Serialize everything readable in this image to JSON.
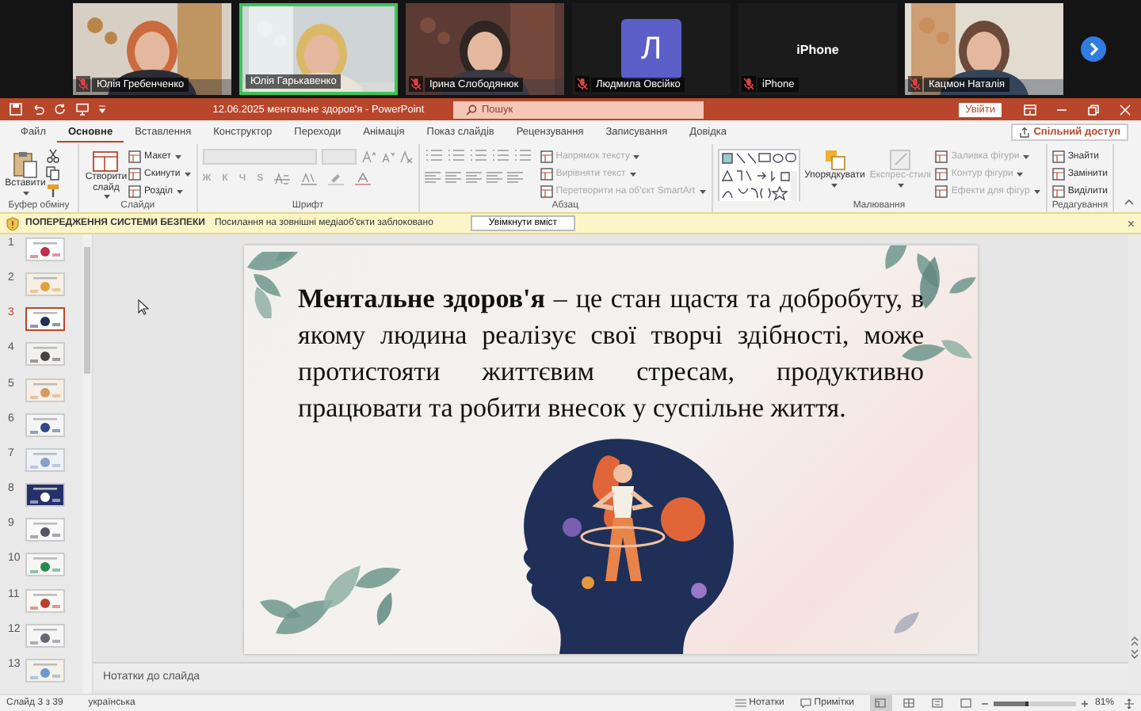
{
  "meeting": {
    "participants": [
      {
        "name": "Юлія Гребенченко",
        "kind": "video",
        "muted": true,
        "speaking": false
      },
      {
        "name": "Юлія Гарькавенко",
        "kind": "video",
        "muted": false,
        "speaking": true
      },
      {
        "name": "Ірина Слободянюк",
        "kind": "video",
        "muted": true,
        "speaking": false
      },
      {
        "name": "Людмила Овсійко",
        "kind": "avatar",
        "initial": "Л",
        "muted": true,
        "speaking": false
      },
      {
        "name": "iPhone",
        "kind": "device",
        "title": "iPhone",
        "muted": true,
        "speaking": false
      },
      {
        "name": "Кацмон Наталія",
        "kind": "video",
        "muted": true,
        "speaking": false
      }
    ]
  },
  "title_bar": {
    "title": "12.06.2025 ментальне здоров'я - PowerPoint",
    "search": {
      "placeholder": "Пошук"
    },
    "sign_in": "Увійти"
  },
  "ribbon": {
    "tabs": [
      {
        "label": "Файл",
        "selected": false
      },
      {
        "label": "Основне",
        "selected": true
      },
      {
        "label": "Вставлення",
        "selected": false
      },
      {
        "label": "Конструктор",
        "selected": false
      },
      {
        "label": "Переходи",
        "selected": false
      },
      {
        "label": "Анімація",
        "selected": false
      },
      {
        "label": "Показ слайдів",
        "selected": false
      },
      {
        "label": "Рецензування",
        "selected": false
      },
      {
        "label": "Записування",
        "selected": false
      },
      {
        "label": "Довідка",
        "selected": false
      }
    ],
    "share": "Спільний доступ",
    "groups": [
      {
        "kind": "clipboard",
        "title": "Буфер обміну",
        "items": [
          {
            "label": "Вставити"
          }
        ]
      },
      {
        "kind": "slides",
        "title": "Слайди",
        "items": [
          {
            "label": "Створити слайд"
          },
          {
            "label": "Макет"
          },
          {
            "label": "Скинути"
          },
          {
            "label": "Розділ"
          }
        ]
      },
      {
        "kind": "font",
        "title": "Шрифт",
        "disabled": true,
        "buttons": [
          "Ж",
          "К",
          "Ч",
          "S"
        ]
      },
      {
        "kind": "paragraph",
        "title": "Абзац",
        "items": [
          {
            "label": "Напрямок тексту",
            "disabled": true
          },
          {
            "label": "Вирівняти текст",
            "disabled": true
          },
          {
            "label": "Перетворити на об'єкт SmartArt",
            "disabled": true
          }
        ]
      },
      {
        "kind": "drawing",
        "title": "Малювання",
        "items": [
          {
            "label": "Упорядкувати",
            "disabled": false
          },
          {
            "label": "Експрес-стилі",
            "disabled": true
          },
          {
            "label": "Заливка фігури",
            "disabled": true
          },
          {
            "label": "Контур фігури",
            "disabled": true
          },
          {
            "label": "Ефекти для фігур",
            "disabled": true
          }
        ]
      },
      {
        "kind": "editing",
        "title": "Редагування",
        "items": [
          {
            "label": "Знайти"
          },
          {
            "label": "Замінити"
          },
          {
            "label": "Виділити"
          }
        ]
      }
    ]
  },
  "security_bar": {
    "title": "ПОПЕРЕДЖЕННЯ СИСТЕМИ БЕЗПЕКИ",
    "message": "Посилання на зовнішні медіаоб'єкти заблоковано",
    "button": "Увімкнути вміст",
    "close": "×"
  },
  "slides_panel": {
    "slides": [
      {
        "number": "1",
        "selected": false
      },
      {
        "number": "2",
        "selected": false
      },
      {
        "number": "3",
        "selected": true
      },
      {
        "number": "4",
        "selected": false
      },
      {
        "number": "5",
        "selected": false
      },
      {
        "number": "6",
        "selected": false
      },
      {
        "number": "7",
        "selected": false
      },
      {
        "number": "8",
        "selected": false
      },
      {
        "number": "9",
        "selected": false
      },
      {
        "number": "10",
        "selected": false
      },
      {
        "number": "11",
        "selected": false
      },
      {
        "number": "12",
        "selected": false
      },
      {
        "number": "13",
        "selected": false
      }
    ]
  },
  "slide": {
    "text": "**Ментальне здоров'я** – це стан щастя та добробуту, в якому людина реалізує свої творчі здібності, може протистояти життєвим стресам, продуктивно працювати та робити внесок у суспільне життя."
  },
  "notes": {
    "placeholder": "Нотатки до слайда"
  },
  "status_bar": {
    "slide_position": "Слайд 3 з 39",
    "language": "українська",
    "notes_button": "Нотатки",
    "comments_button": "Примітки",
    "views": [
      {
        "selected": true
      },
      {
        "selected": false
      },
      {
        "selected": false
      },
      {
        "selected": false
      }
    ],
    "zoom": {
      "level": 0.43,
      "reading": "81%"
    }
  }
}
